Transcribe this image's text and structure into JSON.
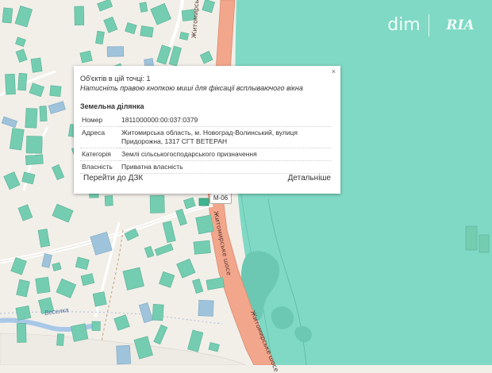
{
  "popup": {
    "objects_count": "Об'єктів в цій точці: 1",
    "hint": "Натисніть правою кнопкою миші для фіксації всплываючого вікна",
    "close_symbol": "×",
    "section_title": "Земельна ділянка",
    "rows": [
      {
        "key": "Номер",
        "value": "1811000000:00:037:0379"
      },
      {
        "key": "Адреса",
        "value": "Житомирська область, м. Новоград-Волинський, вулиця Придорожна, 1317 СГТ ВЕТЕРАН"
      },
      {
        "key": "Категорія",
        "value": "Землі сільськогосподарського призначення"
      },
      {
        "key": "Власність",
        "value": "Приватна власність"
      }
    ],
    "link_left": "Перейти до ДЗК",
    "link_right": "Детальніше"
  },
  "map": {
    "road_name": "Житомирське шосе",
    "road_ref": "М-06",
    "place_name": "Веселка",
    "colors": {
      "land": "#f2efe9",
      "water": "#7fd9c4",
      "parcel": "#74cdb1",
      "road": "#f2a68c",
      "road_edge": "#d98a70"
    }
  },
  "watermark": {
    "left": "dim",
    "right": "RIA"
  }
}
